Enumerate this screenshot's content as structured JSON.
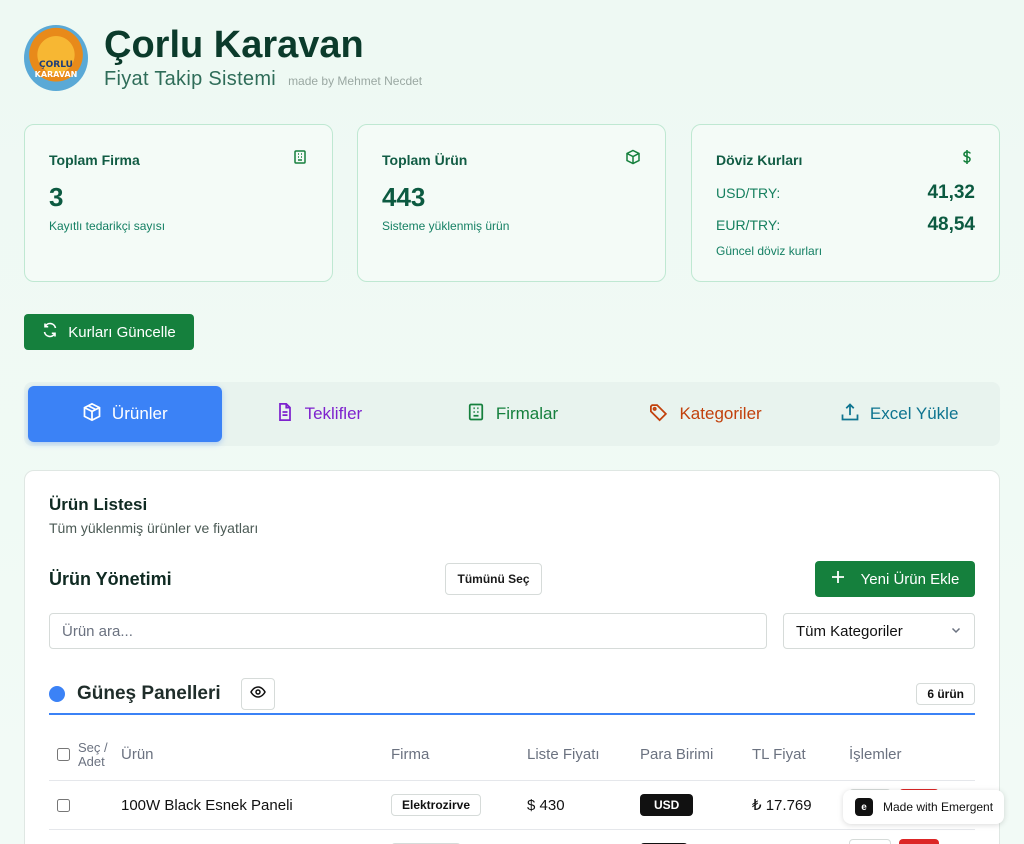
{
  "header": {
    "logo_line1": "ÇORLU",
    "logo_line2": "KARAVAN",
    "title": "Çorlu Karavan",
    "subtitle": "Fiyat Takip Sistemi",
    "made_by": "made by Mehmet Necdet"
  },
  "stats": {
    "firms": {
      "title": "Toplam Firma",
      "value": "3",
      "sub": "Kayıtlı tedarikçi sayısı",
      "icon": "building-icon"
    },
    "products": {
      "title": "Toplam Ürün",
      "value": "443",
      "sub": "Sisteme yüklenmiş ürün",
      "icon": "package-icon"
    },
    "rates": {
      "title": "Döviz Kurları",
      "icon": "dollar-icon",
      "usd_label": "USD/TRY:",
      "usd_value": "41,32",
      "eur_label": "EUR/TRY:",
      "eur_value": "48,54",
      "sub": "Güncel döviz kurları"
    }
  },
  "update_button": "Kurları Güncelle",
  "tabs": [
    {
      "label": "Ürünler",
      "color": "#ffffff"
    },
    {
      "label": "Teklifler",
      "color": "#7e22ce"
    },
    {
      "label": "Firmalar",
      "color": "#15803d"
    },
    {
      "label": "Kategoriler",
      "color": "#c2410c"
    },
    {
      "label": "Excel Yükle",
      "color": "#0e7490"
    }
  ],
  "panel": {
    "title": "Ürün Listesi",
    "subtitle": "Tüm yüklenmiş ürünler ve fiyatları",
    "management_title": "Ürün Yönetimi",
    "select_all": "Tümünü Seç",
    "add_product": "Yeni Ürün Ekle",
    "search_placeholder": "Ürün ara...",
    "category_selected": "Tüm Kategoriler"
  },
  "group": {
    "name": "Güneş Panelleri",
    "count": "6 ürün",
    "color": "#3b82f6"
  },
  "table": {
    "headers": {
      "select": "Seç / Adet",
      "product": "Ürün",
      "firm": "Firma",
      "list_price": "Liste Fiyatı",
      "currency": "Para Birimi",
      "tl_price": "TL Fiyat",
      "actions": "İşlemler"
    },
    "rows": [
      {
        "product": "100W Black Esnek Paneli",
        "firm": "Elektrozirve",
        "list_price": "$ 430",
        "currency": "USD",
        "tl_price": "₺ 17.769"
      }
    ]
  },
  "badge": {
    "label": "Made with Emergent"
  }
}
